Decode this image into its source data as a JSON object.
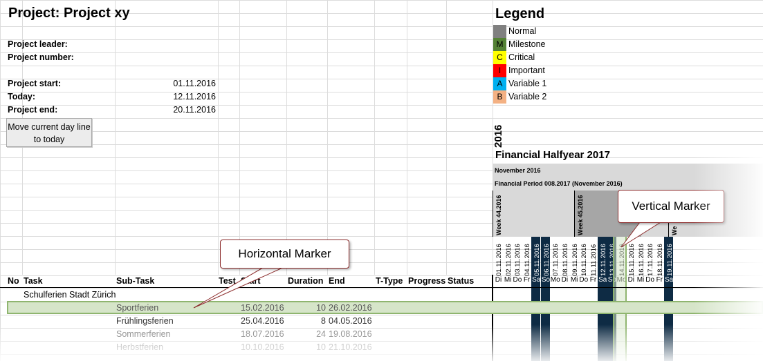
{
  "project": {
    "title": "Project: Project xy",
    "leader_label": "Project leader:",
    "number_label": "Project number:",
    "start_label": "Project start:",
    "start_value": "01.11.2016",
    "today_label": "Today:",
    "today_value": "12.11.2016",
    "end_label": "Project end:",
    "end_value": "20.11.2016"
  },
  "button": {
    "label": "Move current day line to today"
  },
  "legend": {
    "title": "Legend",
    "items": [
      {
        "code": "",
        "label": "Normal",
        "color": "#808080"
      },
      {
        "code": "M",
        "label": "Milestone",
        "color": "#548235"
      },
      {
        "code": "C",
        "label": "Critical",
        "color": "#ffff00"
      },
      {
        "code": "I",
        "label": "Important",
        "color": "#ff0000"
      },
      {
        "code": "A",
        "label": "Variable 1",
        "color": "#00b0f0"
      },
      {
        "code": "B",
        "label": "Variable 2",
        "color": "#f4b183"
      }
    ]
  },
  "calendar": {
    "year": "2016",
    "fin_halfyear": "Financial Halfyear 2017",
    "month": "November 2016",
    "fin_period": "Financial Period 008.2017 (November 2016)",
    "weeks": [
      "Week 44.2016",
      "Week 45.2016",
      "We"
    ],
    "days": [
      {
        "date": "01.11.2016",
        "wd": "Di"
      },
      {
        "date": "02.11.2016",
        "wd": "Mi"
      },
      {
        "date": "03.11.2016",
        "wd": "Do"
      },
      {
        "date": "04.11.2016",
        "wd": "Fr"
      },
      {
        "date": "05.11.2016",
        "wd": "Sa"
      },
      {
        "date": "06.11.2016",
        "wd": "So"
      },
      {
        "date": "07.11.2016",
        "wd": "Mo"
      },
      {
        "date": "08.11.2016",
        "wd": "Di"
      },
      {
        "date": "09.11.2016",
        "wd": "Mi"
      },
      {
        "date": "10.11.2016",
        "wd": "Do"
      },
      {
        "date": "11.11.2016",
        "wd": "Fr"
      },
      {
        "date": "12.11.2016",
        "wd": "Sa"
      },
      {
        "date": "13.11.2016",
        "wd": "So"
      },
      {
        "date": "14.11.2016",
        "wd": "Mo"
      },
      {
        "date": "15.11.2016",
        "wd": "Di"
      },
      {
        "date": "16.11.2016",
        "wd": "Mi"
      },
      {
        "date": "17.11.2016",
        "wd": "Do"
      },
      {
        "date": "18.11.2016",
        "wd": "Fr"
      },
      {
        "date": "19.11.2016",
        "wd": "Sa"
      }
    ]
  },
  "table": {
    "headers": [
      "No",
      "Task",
      "Sub-Task",
      "Test",
      "Start",
      "Duration",
      "End",
      "T-Type",
      "Progress",
      "Status"
    ],
    "group": "Schulferien Stadt Zürich",
    "rows": [
      {
        "subtask": "Sportferien",
        "start": "15.02.2016",
        "duration": "10",
        "end": "26.02.2016"
      },
      {
        "subtask": "Frühlingsferien",
        "start": "25.04.2016",
        "duration": "8",
        "end": "04.05.2016"
      },
      {
        "subtask": "Sommerferien",
        "start": "18.07.2016",
        "duration": "24",
        "end": "19.08.2016"
      },
      {
        "subtask": "Herbstferien",
        "start": "10.10.2016",
        "duration": "10",
        "end": "21.10.2016"
      }
    ]
  },
  "callouts": {
    "horizontal": "Horizontal Marker",
    "vertical": "Vertical Marker"
  },
  "colors": {
    "weekend": "#0e2b44",
    "marker_fill": "#d6e5c9",
    "marker_border": "#8fb56f",
    "callout_border": "#8b2a2a"
  }
}
